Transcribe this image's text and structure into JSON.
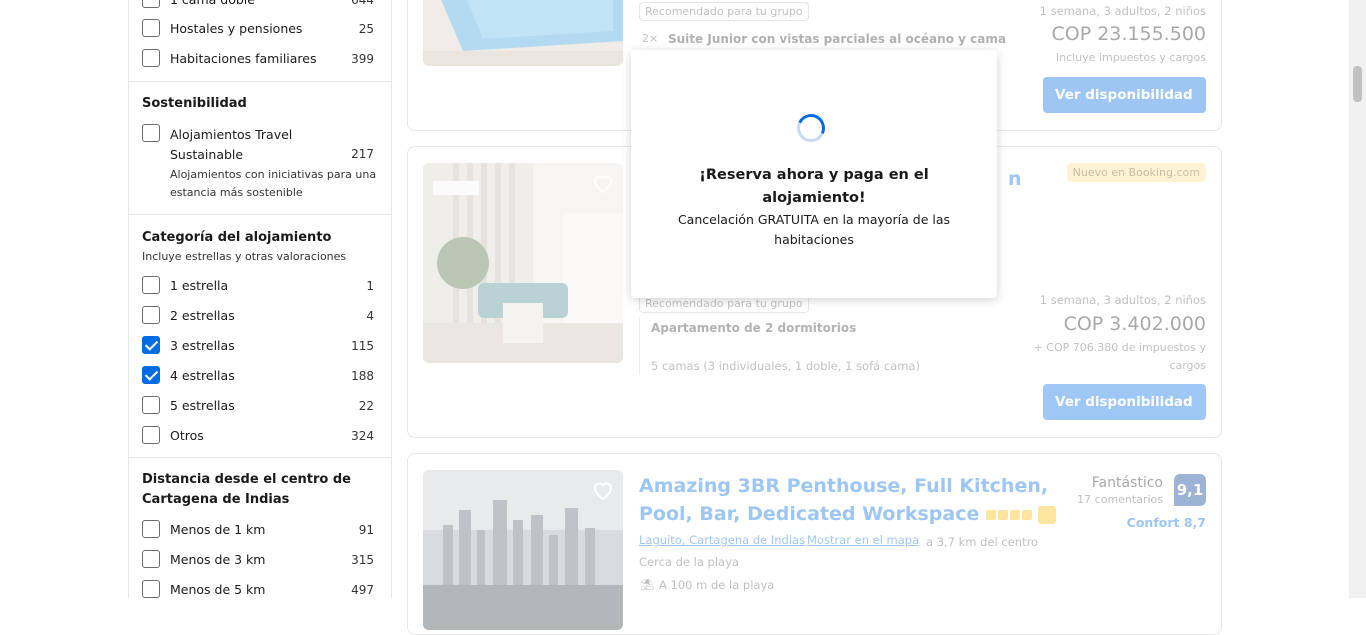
{
  "sidebar": {
    "top_options": [
      {
        "label": "1 cama doble",
        "count": "644",
        "checked": false
      },
      {
        "label": "Hostales y pensiones",
        "count": "25",
        "checked": false
      },
      {
        "label": "Habitaciones familiares",
        "count": "399",
        "checked": false
      }
    ],
    "sustainability": {
      "title": "Sostenibilidad",
      "option_label": "Alojamientos Travel Sustainable",
      "option_count": "217",
      "option_desc": "Alojamientos con iniciativas para una estancia más sostenible"
    },
    "category": {
      "title": "Categoría del alojamiento",
      "subtitle": "Incluye estrellas y otras valoraciones",
      "options": [
        {
          "label": "1 estrella",
          "count": "1",
          "checked": false
        },
        {
          "label": "2 estrellas",
          "count": "4",
          "checked": false
        },
        {
          "label": "3 estrellas",
          "count": "115",
          "checked": true
        },
        {
          "label": "4 estrellas",
          "count": "188",
          "checked": true
        },
        {
          "label": "5 estrellas",
          "count": "22",
          "checked": false
        },
        {
          "label": "Otros",
          "count": "324",
          "checked": false
        }
      ]
    },
    "distance": {
      "title": "Distancia desde el centro de Cartagena de Indias",
      "options": [
        {
          "label": "Menos de 1 km",
          "count": "91",
          "checked": false
        },
        {
          "label": "Menos de 3 km",
          "count": "315",
          "checked": false
        },
        {
          "label": "Menos de 5 km",
          "count": "497",
          "checked": false
        }
      ]
    }
  },
  "results": [
    {
      "tag": "Recomendado para tu grupo",
      "room_multiplier": "2×",
      "room_name": "Suite Junior con vistas parciales al océano y cama",
      "stay": "1 semana, 3 adultos, 2 niños",
      "price": "COP 23.155.500",
      "tax": "Incluye impuestos y cargos",
      "button": "Ver disponibilidad"
    },
    {
      "new_badge": "Nuevo en Booking.com",
      "title_fragment": "n",
      "tag": "Recomendado para tu grupo",
      "room_name": "Apartamento de 2 dormitorios",
      "beds": "5 camas (3 individuales, 1 doble, 1 sofá cama)",
      "stay": "1 semana, 3 adultos, 2 niños",
      "price": "COP 3.402.000",
      "tax": "+ COP 706.380 de impuestos y cargos",
      "button": "Ver disponibilidad"
    },
    {
      "title": "Amazing 3BR Penthouse, Full Kitchen, Pool, Bar, Dedicated Workspace",
      "stars": 4,
      "location_link": "Laguito, Cartagena de Indias",
      "map_link": "Mostrar en el mapa",
      "distance": "a 3,7 km del centro",
      "beach": "Cerca de la playa",
      "beach_distance": "A 100 m de la playa",
      "score_word": "Fantástico",
      "reviews": "17 comentarios",
      "score": "9,1",
      "comfort": "Confort 8,7"
    }
  ],
  "modal": {
    "title": "¡Reserva ahora y paga en el alojamiento!",
    "text": "Cancelación GRATUITA en la mayoría de las habitaciones"
  },
  "colors": {
    "brand_blue": "#006ce4",
    "score_blue": "#003b95",
    "badge_yellow": "#febb02"
  }
}
